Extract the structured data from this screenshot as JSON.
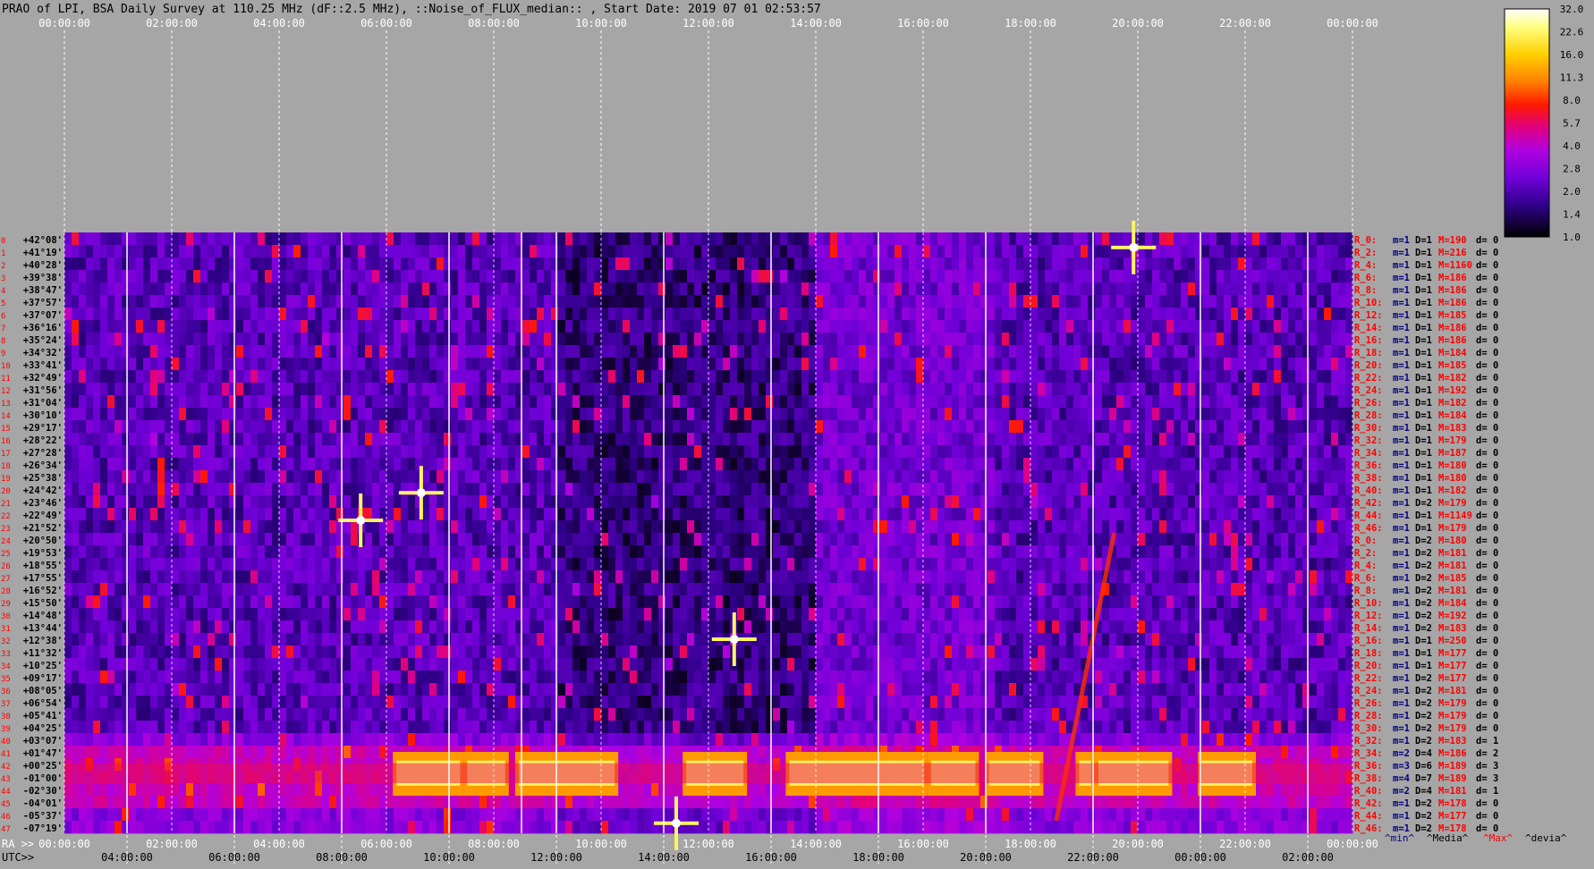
{
  "title": "PRAO of LPI, BSA Daily Survey at 110.25 MHz (dF::2.5 MHz), ::Noise_of_FLUX_median:: , Start Date: 2019 07 01 02:53:57",
  "colors": {
    "background": "#a6a6a6",
    "label_red": "#ff0000",
    "label_blue": "#000080",
    "grid": "#ffffff",
    "colorbar": [
      "#000000",
      "#10003a",
      "#3a008a",
      "#7a00d8",
      "#b000e0",
      "#e00070",
      "#ff2000",
      "#ff8000",
      "#ffd000",
      "#ffff60",
      "#ffffff"
    ]
  },
  "chart_data": {
    "type": "heatmap",
    "top_axis_labels": [
      "00:00:00",
      "02:00:00",
      "04:00:00",
      "06:00:00",
      "08:00:00",
      "10:00:00",
      "12:00:00",
      "14:00:00",
      "16:00:00",
      "18:00:00",
      "20:00:00",
      "22:00:00",
      "00:00:00"
    ],
    "ra_axis_prefix": "RA >>",
    "ra_axis_labels": [
      "00:00:00",
      "02:00:00",
      "04:00:00",
      "06:00:00",
      "08:00:00",
      "10:00:00",
      "12:00:00",
      "14:00:00",
      "16:00:00",
      "18:00:00",
      "20:00:00",
      "22:00:00",
      "00:00:00"
    ],
    "utc_axis_prefix": "UTC>>",
    "utc_axis_labels": [
      "04:00:00",
      "06:00:00",
      "08:00:00",
      "10:00:00",
      "12:00:00",
      "14:00:00",
      "16:00:00",
      "18:00:00",
      "20:00:00",
      "22:00:00",
      "00:00:00",
      "02:00:00"
    ],
    "dec_labels": [
      "+42°08'",
      "+41°19'",
      "+40°28'",
      "+39°38'",
      "+38°47'",
      "+37°57'",
      "+37°07'",
      "+36°16'",
      "+35°24'",
      "+34°32'",
      "+33°41'",
      "+32°49'",
      "+31°56'",
      "+31°04'",
      "+30°10'",
      "+29°17'",
      "+28°22'",
      "+27°28'",
      "+26°34'",
      "+25°38'",
      "+24°42'",
      "+23°46'",
      "+22°49'",
      "+21°52'",
      "+20°50'",
      "+19°53'",
      "+18°55'",
      "+17°55'",
      "+16°52'",
      "+15°50'",
      "+14°48'",
      "+13°44'",
      "+12°38'",
      "+11°32'",
      "+10°25'",
      "+09°17'",
      "+08°05'",
      "+06°54'",
      "+05°41'",
      "+04°25'",
      "+03°07'",
      "+01°47'",
      "+00°25'",
      "-01°00'",
      "-02°30'",
      "-04°01'",
      "-05°37'",
      "-07°19'"
    ],
    "colorbar_ticks": [
      "32.0",
      "22.6",
      "16.0",
      "11.3",
      "8.0",
      "5.7",
      "4.0",
      "2.8",
      "2.0",
      "1.4",
      "1.0"
    ],
    "colorbar_values": [
      32.0,
      22.6,
      16.0,
      11.3,
      8.0,
      5.7,
      4.0,
      2.8,
      2.0,
      1.4,
      1.0
    ],
    "row_stats": [
      {
        "r": "R_0:",
        "m": "m=1",
        "d": "D=1",
        "M": "M=190",
        "dv": "d= 0"
      },
      {
        "r": "R_2:",
        "m": "m=1",
        "d": "D=1",
        "M": "M=216",
        "dv": "d= 0"
      },
      {
        "r": "R_4:",
        "m": "m=1",
        "d": "D=1",
        "M": "M=1160",
        "dv": "d= 0"
      },
      {
        "r": "R_6:",
        "m": "m=1",
        "d": "D=1",
        "M": "M=186",
        "dv": "d= 0"
      },
      {
        "r": "R_8:",
        "m": "m=1",
        "d": "D=1",
        "M": "M=186",
        "dv": "d= 0"
      },
      {
        "r": "R_10:",
        "m": "m=1",
        "d": "D=1",
        "M": "M=186",
        "dv": "d= 0"
      },
      {
        "r": "R_12:",
        "m": "m=1",
        "d": "D=1",
        "M": "M=185",
        "dv": "d= 0"
      },
      {
        "r": "R_14:",
        "m": "m=1",
        "d": "D=1",
        "M": "M=186",
        "dv": "d= 0"
      },
      {
        "r": "R_16:",
        "m": "m=1",
        "d": "D=1",
        "M": "M=186",
        "dv": "d= 0"
      },
      {
        "r": "R_18:",
        "m": "m=1",
        "d": "D=1",
        "M": "M=184",
        "dv": "d= 0"
      },
      {
        "r": "R_20:",
        "m": "m=1",
        "d": "D=1",
        "M": "M=185",
        "dv": "d= 0"
      },
      {
        "r": "R_22:",
        "m": "m=1",
        "d": "D=1",
        "M": "M=182",
        "dv": "d= 0"
      },
      {
        "r": "R_24:",
        "m": "m=1",
        "d": "D=1",
        "M": "M=192",
        "dv": "d= 0"
      },
      {
        "r": "R_26:",
        "m": "m=1",
        "d": "D=1",
        "M": "M=182",
        "dv": "d= 0"
      },
      {
        "r": "R_28:",
        "m": "m=1",
        "d": "D=1",
        "M": "M=184",
        "dv": "d= 0"
      },
      {
        "r": "R_30:",
        "m": "m=1",
        "d": "D=1",
        "M": "M=183",
        "dv": "d= 0"
      },
      {
        "r": "R_32:",
        "m": "m=1",
        "d": "D=1",
        "M": "M=179",
        "dv": "d= 0"
      },
      {
        "r": "R_34:",
        "m": "m=1",
        "d": "D=1",
        "M": "M=187",
        "dv": "d= 0"
      },
      {
        "r": "R_36:",
        "m": "m=1",
        "d": "D=1",
        "M": "M=180",
        "dv": "d= 0"
      },
      {
        "r": "R_38:",
        "m": "m=1",
        "d": "D=1",
        "M": "M=180",
        "dv": "d= 0"
      },
      {
        "r": "R_40:",
        "m": "m=1",
        "d": "D=1",
        "M": "M=182",
        "dv": "d= 0"
      },
      {
        "r": "R_42:",
        "m": "m=1",
        "d": "D=2",
        "M": "M=179",
        "dv": "d= 0"
      },
      {
        "r": "R_44:",
        "m": "m=1",
        "d": "D=1",
        "M": "M=1149",
        "dv": "d= 0"
      },
      {
        "r": "R_46:",
        "m": "m=1",
        "d": "D=1",
        "M": "M=179",
        "dv": "d= 0"
      },
      {
        "r": "R_0:",
        "m": "m=1",
        "d": "D=2",
        "M": "M=180",
        "dv": "d= 0"
      },
      {
        "r": "R_2:",
        "m": "m=1",
        "d": "D=2",
        "M": "M=181",
        "dv": "d= 0"
      },
      {
        "r": "R_4:",
        "m": "m=1",
        "d": "D=2",
        "M": "M=181",
        "dv": "d= 0"
      },
      {
        "r": "R_6:",
        "m": "m=1",
        "d": "D=2",
        "M": "M=185",
        "dv": "d= 0"
      },
      {
        "r": "R_8:",
        "m": "m=1",
        "d": "D=2",
        "M": "M=181",
        "dv": "d= 0"
      },
      {
        "r": "R_10:",
        "m": "m=1",
        "d": "D=2",
        "M": "M=184",
        "dv": "d= 0"
      },
      {
        "r": "R_12:",
        "m": "m=1",
        "d": "D=2",
        "M": "M=192",
        "dv": "d= 0"
      },
      {
        "r": "R_14:",
        "m": "m=1",
        "d": "D=2",
        "M": "M=183",
        "dv": "d= 0"
      },
      {
        "r": "R_16:",
        "m": "m=1",
        "d": "D=1",
        "M": "M=250",
        "dv": "d= 0"
      },
      {
        "r": "R_18:",
        "m": "m=1",
        "d": "D=1",
        "M": "M=177",
        "dv": "d= 0"
      },
      {
        "r": "R_20:",
        "m": "m=1",
        "d": "D=1",
        "M": "M=177",
        "dv": "d= 0"
      },
      {
        "r": "R_22:",
        "m": "m=1",
        "d": "D=2",
        "M": "M=177",
        "dv": "d= 0"
      },
      {
        "r": "R_24:",
        "m": "m=1",
        "d": "D=2",
        "M": "M=181",
        "dv": "d= 0"
      },
      {
        "r": "R_26:",
        "m": "m=1",
        "d": "D=2",
        "M": "M=179",
        "dv": "d= 0"
      },
      {
        "r": "R_28:",
        "m": "m=1",
        "d": "D=2",
        "M": "M=179",
        "dv": "d= 0"
      },
      {
        "r": "R_30:",
        "m": "m=1",
        "d": "D=2",
        "M": "M=179",
        "dv": "d= 0"
      },
      {
        "r": "R_32:",
        "m": "m=1",
        "d": "D=2",
        "M": "M=183",
        "dv": "d= 1"
      },
      {
        "r": "R_34:",
        "m": "m=2",
        "d": "D=4",
        "M": "M=186",
        "dv": "d= 2"
      },
      {
        "r": "R_36:",
        "m": "m=3",
        "d": "D=6",
        "M": "M=189",
        "dv": "d= 3"
      },
      {
        "r": "R_38:",
        "m": "m=4",
        "d": "D=7",
        "M": "M=189",
        "dv": "d= 3"
      },
      {
        "r": "R_40:",
        "m": "m=2",
        "d": "D=4",
        "M": "M=181",
        "dv": "d= 1"
      },
      {
        "r": "R_42:",
        "m": "m=1",
        "d": "D=2",
        "M": "M=178",
        "dv": "d= 0"
      },
      {
        "r": "R_44:",
        "m": "m=1",
        "d": "D=2",
        "M": "M=177",
        "dv": "d= 0"
      },
      {
        "r": "R_46:",
        "m": "m=1",
        "d": "D=2",
        "M": "M=178",
        "dv": "d= 0"
      }
    ],
    "stats_legend": {
      "min": "^min^",
      "median": "^Media^",
      "max": "^Max^",
      "devia": "^devia^"
    }
  }
}
